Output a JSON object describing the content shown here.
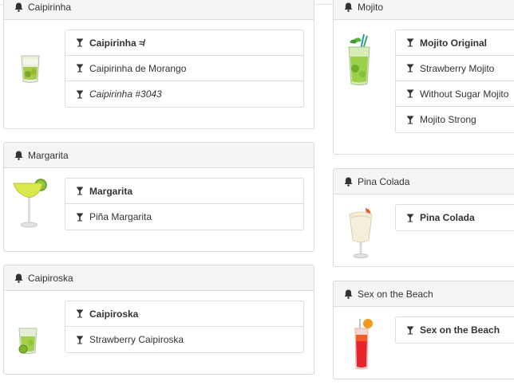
{
  "cards": [
    {
      "title": "Caipirinha",
      "items": [
        {
          "label": "Caipirinha ≉",
          "style": "bold"
        },
        {
          "label": "Caipirinha de Morango",
          "style": ""
        },
        {
          "label": "Caipirinha #3043",
          "style": "italic"
        }
      ]
    },
    {
      "title": "Mojito",
      "items": [
        {
          "label": "Mojito Original",
          "style": "bold"
        },
        {
          "label": "Strawberry Mojito",
          "style": ""
        },
        {
          "label": "Without Sugar Mojito",
          "style": ""
        },
        {
          "label": "Mojito Strong",
          "style": ""
        }
      ]
    },
    {
      "title": "Margarita",
      "items": [
        {
          "label": "Margarita",
          "style": "bold"
        },
        {
          "label": "Piña Margarita",
          "style": ""
        }
      ]
    },
    {
      "title": "Pina Colada",
      "items": [
        {
          "label": "Pina Colada",
          "style": "bold"
        }
      ]
    },
    {
      "title": "Caipiroska",
      "items": [
        {
          "label": "Caipiroska",
          "style": "bold"
        },
        {
          "label": "Strawberry Caipiroska",
          "style": ""
        }
      ]
    },
    {
      "title": "Sex on the Beach",
      "items": [
        {
          "label": "Sex on the Beach",
          "style": "bold"
        }
      ]
    }
  ],
  "icons": {
    "header": "bell-icon",
    "item": "cocktail-glass-icon"
  }
}
